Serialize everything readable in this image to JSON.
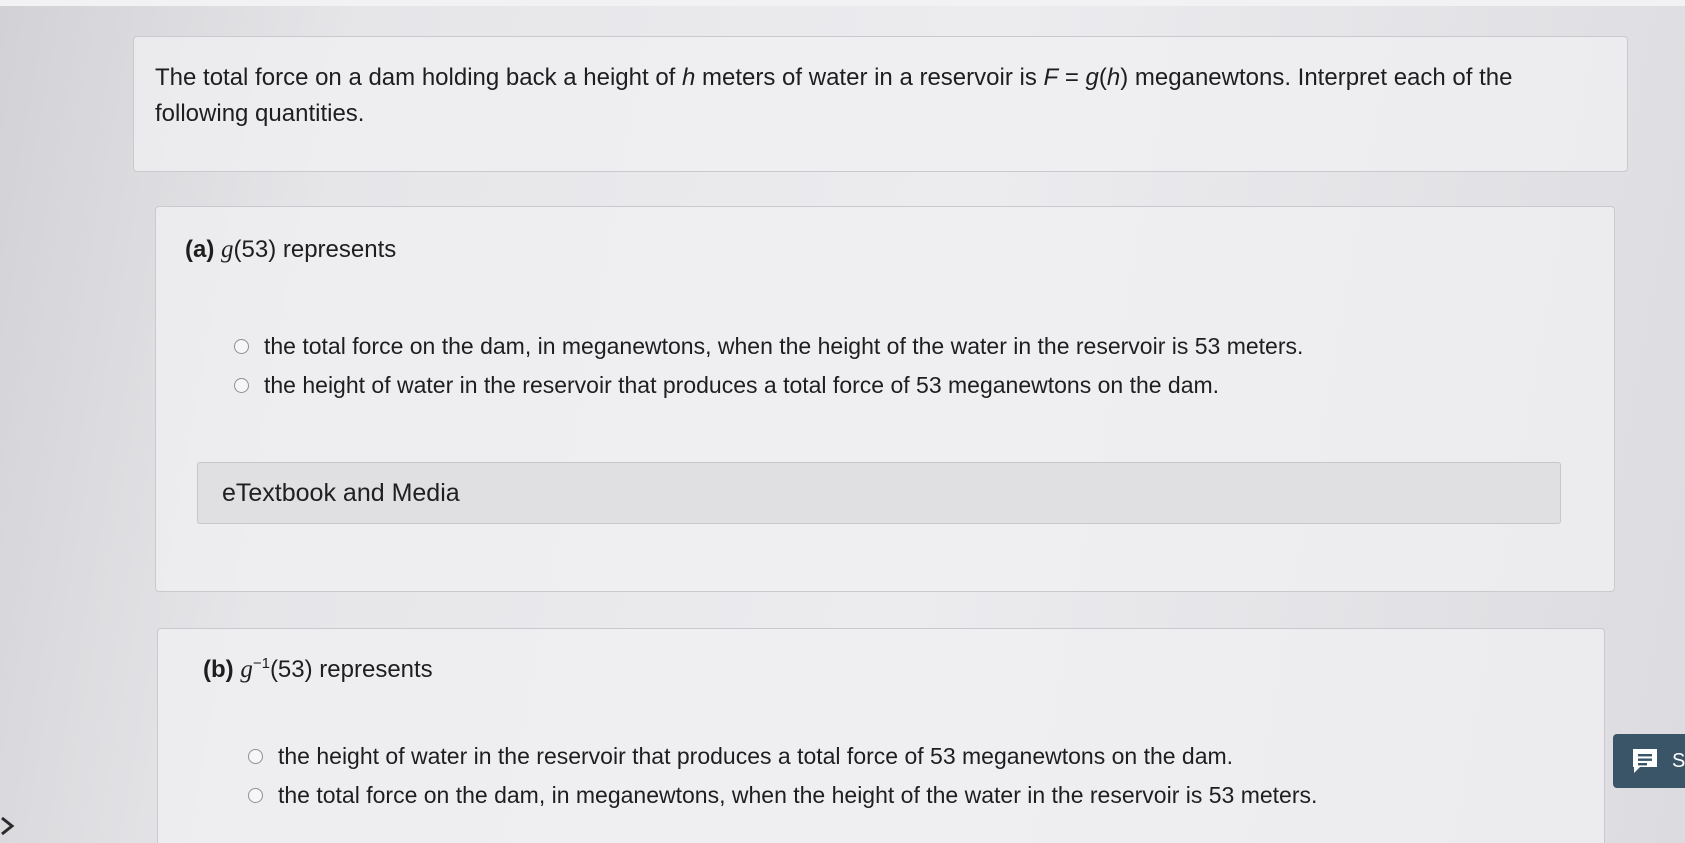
{
  "question": {
    "text_before_h": "The total force on a dam holding back a height of ",
    "var_h": "h",
    "text_mid": " meters of water in a reservoir is ",
    "var_F": "F",
    "equals": " = ",
    "func_g": "g",
    "paren_open": "(",
    "var_h2": "h",
    "paren_close": ")",
    "text_after": " meganewtons. Interpret each of the following quantities."
  },
  "part_a": {
    "label": "(a)",
    "func": "g",
    "argument": "(53)",
    "represents": " represents",
    "options": [
      "the total force on the dam, in meganewtons, when the height of the water in the reservoir is 53 meters.",
      "the height of water in the reservoir that produces a total force of 53 meganewtons on the dam."
    ]
  },
  "media": {
    "label": "eTextbook and Media"
  },
  "part_b": {
    "label": "(b)",
    "func": "g",
    "exponent": "−1",
    "argument": "(53)",
    "represents": " represents",
    "options": [
      "the height of water in the reservoir that produces a total force of 53 meganewtons on the dam.",
      "the total force on the dam, in meganewtons, when the height of the water in the reservoir is 53 meters."
    ]
  },
  "chat": {
    "label": "S",
    "icon": "chat-bubble-icon",
    "color": "#3a5568"
  }
}
